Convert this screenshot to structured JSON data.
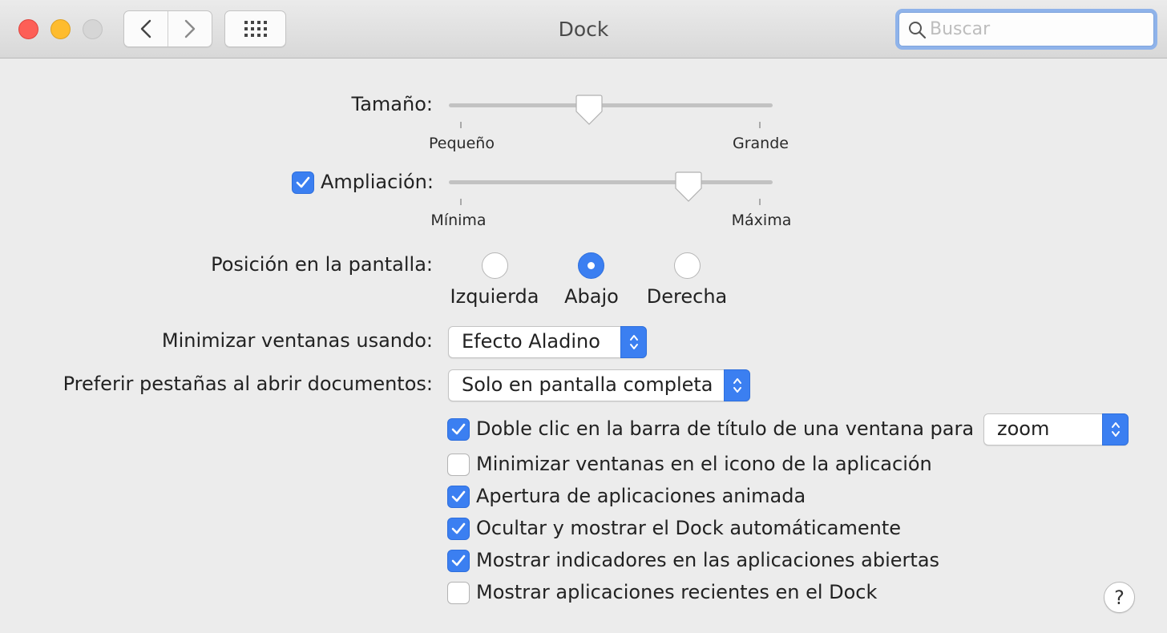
{
  "window": {
    "title": "Dock",
    "search": {
      "placeholder": "Buscar",
      "value": ""
    }
  },
  "size": {
    "label": "Tamaño:",
    "min_label": "Pequeño",
    "max_label": "Grande",
    "value_fraction": 0.43
  },
  "magnification": {
    "checked": true,
    "label": "Ampliación:",
    "min_label": "Mínima",
    "max_label": "Máxima",
    "value_fraction": 0.74
  },
  "position": {
    "label": "Posición en la pantalla:",
    "options": [
      "Izquierda",
      "Abajo",
      "Derecha"
    ],
    "selected": "Abajo"
  },
  "minimize_effect": {
    "label": "Minimizar ventanas usando:",
    "value": "Efecto Aladino"
  },
  "prefer_tabs": {
    "label": "Preferir pestañas al abrir documentos:",
    "value": "Solo en pantalla completa"
  },
  "double_click": {
    "checked": true,
    "label": "Doble clic en la barra de título de una ventana para",
    "value": "zoom"
  },
  "options": [
    {
      "label": "Minimizar ventanas en el icono de la aplicación",
      "checked": false
    },
    {
      "label": "Apertura de aplicaciones animada",
      "checked": true
    },
    {
      "label": "Ocultar y mostrar el Dock automáticamente",
      "checked": true
    },
    {
      "label": "Mostrar indicadores en las aplicaciones abiertas",
      "checked": true
    },
    {
      "label": "Mostrar aplicaciones recientes en el Dock",
      "checked": false
    }
  ],
  "help": {
    "label": "?"
  },
  "colors": {
    "accent": "#3b7ff1",
    "window_bg": "#ececec",
    "search_focus_ring": "#8fb3ea"
  }
}
